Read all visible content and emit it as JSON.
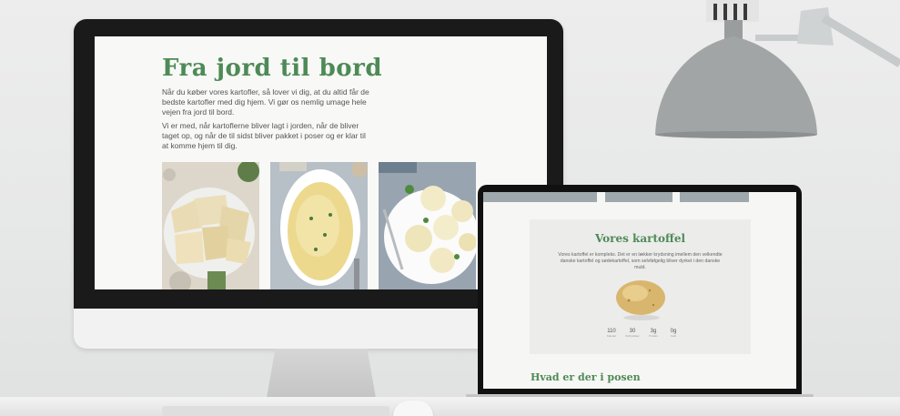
{
  "desktop_site": {
    "title": "Fra jord til bord",
    "paragraph1": "Når du køber vores kartofler, så lover vi dig, at du altid får de bedste kartofler med dig hjem. Vi gør os nemlig umage hele vejen fra jord til bord.",
    "paragraph2": "Vi er med, når kartoflerne bliver lagt i jorden, når de bliver taget op, og når de til sidst bliver pakket i poser og er klar til at komme hjem til dig."
  },
  "laptop_site": {
    "card_title": "Vores kartoffel",
    "card_text": "Vores kartoffel er kompleks. Det er en lækker krydsning imellem den velkendte danske kartoffel og sødekartoffel, som selvfølgelig bliver dyrket i den danske muld.",
    "stats": [
      {
        "value": "110",
        "label": "Kalorier"
      },
      {
        "value": "30",
        "label": "Kulhydrater"
      },
      {
        "value": "3g",
        "label": "Protein"
      },
      {
        "value": "0g",
        "label": "Fedt"
      }
    ],
    "section_heading": "Hvad er der i posen"
  },
  "colors": {
    "brand_green": "#4e8a57",
    "body_text": "#555555",
    "screen_bg": "#f8f9f6",
    "card_bg": "#ececeb"
  }
}
